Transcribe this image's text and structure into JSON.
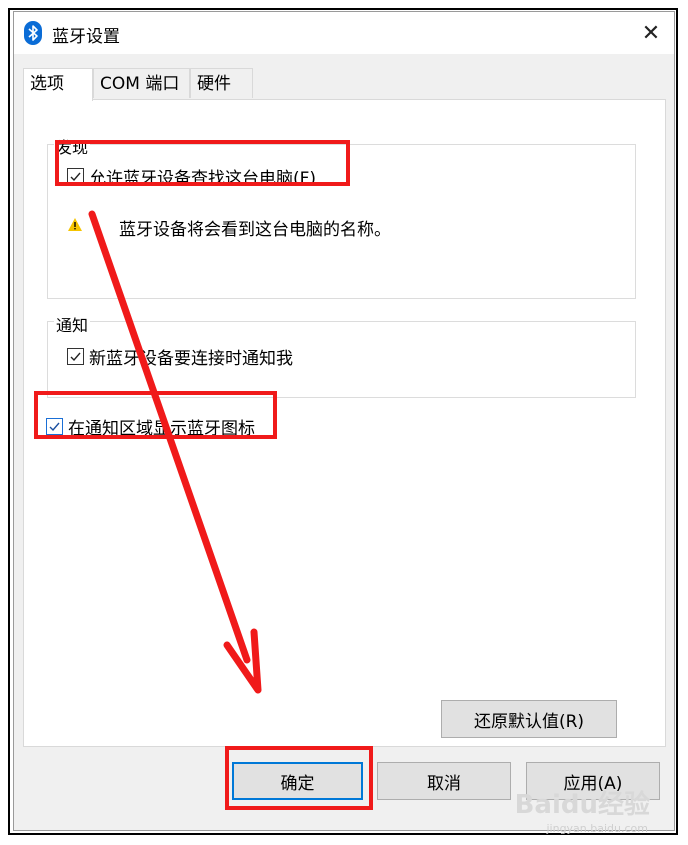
{
  "window": {
    "title": "蓝牙设置",
    "close_label": "✕"
  },
  "tabs": [
    {
      "label": "选项",
      "active": true
    },
    {
      "label": "COM 端口",
      "active": false
    },
    {
      "label": "硬件",
      "active": false
    }
  ],
  "discovery": {
    "legend": "发现",
    "allow_label": "允许蓝牙设备查找这台电脑(F)",
    "allow_checked": true,
    "warning": "蓝牙设备将会看到这台电脑的名称。"
  },
  "notifications": {
    "legend": "通知",
    "notify_label": "新蓝牙设备要连接时通知我",
    "notify_checked": true
  },
  "tray_icon": {
    "label": "在通知区域显示蓝牙图标",
    "checked": true
  },
  "buttons": {
    "restore_defaults": "还原默认值(R)",
    "ok": "确定",
    "cancel": "取消",
    "apply": "应用(A)"
  },
  "watermark": {
    "brand": "Baidu经验",
    "url": "jingyan.baidu.com"
  },
  "colors": {
    "highlight": "#f01a1a",
    "accent": "#0078d7",
    "bluetooth": "#0a6cd6",
    "warning": "#f5c400"
  },
  "icons": {
    "bluetooth": "bluetooth-icon",
    "warning": "warning-icon",
    "close": "close-icon",
    "check": "check-icon"
  }
}
